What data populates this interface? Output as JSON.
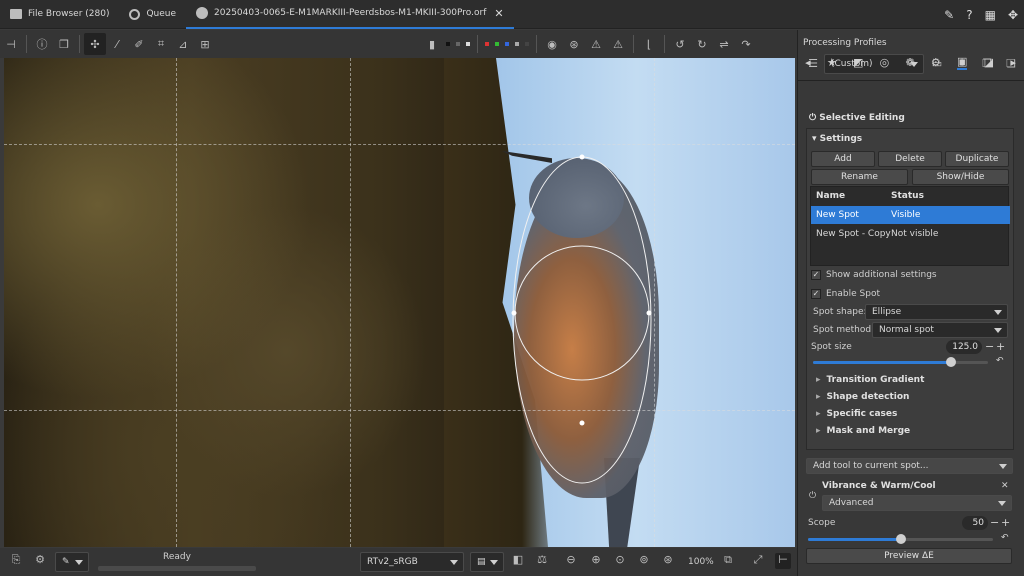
{
  "tabs": [
    {
      "label": "File Browser (280)",
      "icon": "folder-icon"
    },
    {
      "label": "Queue",
      "icon": "gear-icon"
    },
    {
      "label": "20250403-0065-E-M1MARKIII-Peerdsbos-M1-MKIII-300Pro.orf",
      "icon": "aperture-icon"
    }
  ],
  "status": {
    "ready": "Ready",
    "output_profile": "RTv2_sRGB",
    "zoom": "100%"
  },
  "panel": {
    "title": "Processing Profiles",
    "profile_value": "(Custom)",
    "tool_title": "Selective Editing",
    "settings_label": "Settings",
    "buttons": {
      "add": "Add",
      "delete": "Delete",
      "duplicate": "Duplicate",
      "rename": "Rename",
      "showhide": "Show/Hide"
    },
    "table": {
      "col_name": "Name",
      "col_status": "Status",
      "rows": [
        {
          "name": "New Spot",
          "status": "Visible"
        },
        {
          "name": "New Spot - Copy",
          "status": "Not visible"
        }
      ]
    },
    "show_additional": "Show additional settings",
    "enable_spot": "Enable Spot",
    "spot_shape_label": "Spot shape:",
    "spot_shape_value": "Ellipse",
    "spot_method_label": "Spot method:",
    "spot_method_value": "Normal spot",
    "spot_size_label": "Spot size",
    "spot_size_value": "125.0",
    "spot_size_fraction": 0.79,
    "expanders": [
      "Transition Gradient",
      "Shape detection",
      "Specific cases",
      "Mask and Merge"
    ],
    "add_tool": "Add tool to current spot...",
    "vibrance_title": "Vibrance & Warm/Cool",
    "vibrance_mode": "Advanced",
    "scope_label": "Scope",
    "scope_value": "50",
    "scope_fraction": 0.5,
    "preview": "Preview ΔE"
  },
  "colors": {
    "accent": "#2e7bd6"
  }
}
